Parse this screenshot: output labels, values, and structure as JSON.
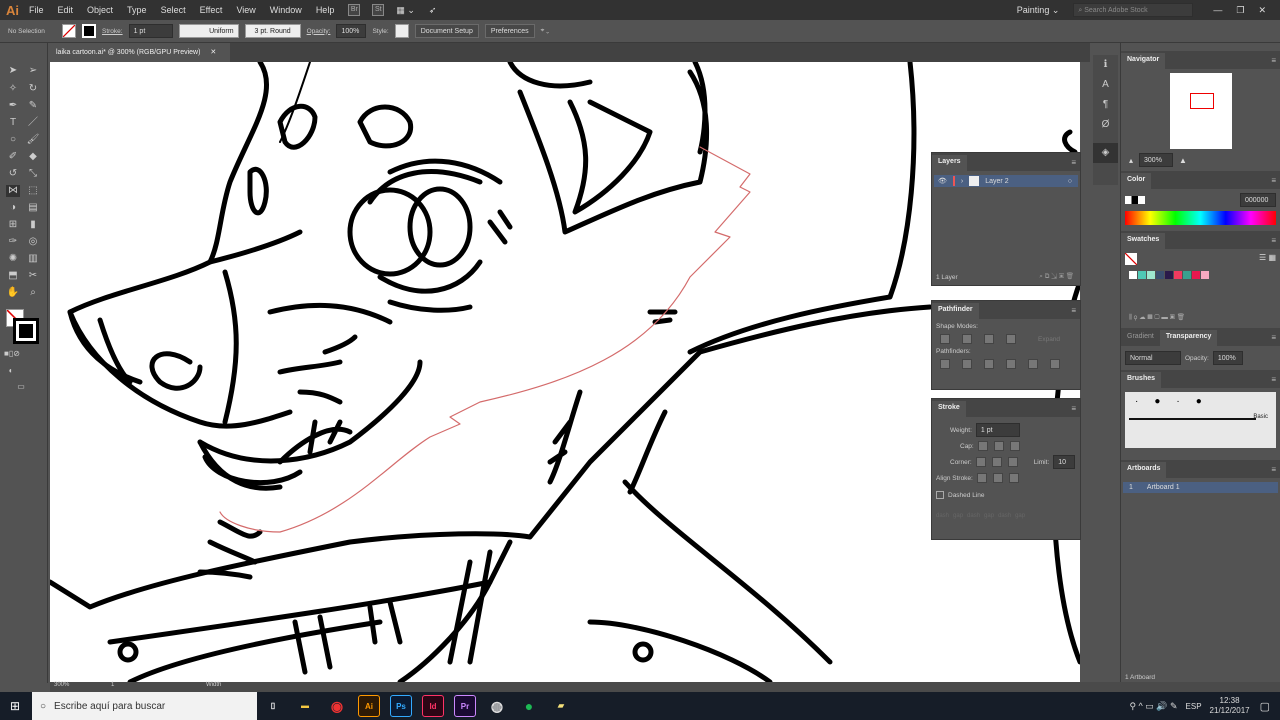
{
  "app": {
    "logo": "Ai",
    "menu": [
      "File",
      "Edit",
      "Object",
      "Type",
      "Select",
      "Effect",
      "View",
      "Window",
      "Help"
    ],
    "bridge": "Br",
    "stock": "St",
    "workspace": "Painting",
    "search_placeholder": "Search Adobe Stock"
  },
  "control": {
    "selection": "No Selection",
    "stroke_label": "Stroke:",
    "stroke_weight": "1 pt",
    "profile": "Uniform",
    "brush": "3 pt. Round",
    "opacity_label": "Opacity:",
    "opacity": "100%",
    "style_label": "Style:",
    "document_setup": "Document Setup",
    "preferences": "Preferences"
  },
  "document": {
    "tab": "laika cartoon.ai* @ 300% (RGB/GPU Preview)"
  },
  "layers": {
    "title": "Layers",
    "layer_name": "Layer 2",
    "count": "1 Layer"
  },
  "pathfinder": {
    "title": "Pathfinder",
    "shape_modes": "Shape Modes:",
    "expand": "Expand",
    "pathfinders": "Pathfinders:"
  },
  "stroke": {
    "title": "Stroke",
    "weight_label": "Weight:",
    "weight": "1 pt",
    "cap_label": "Cap:",
    "corner_label": "Corner:",
    "limit_label": "Limit:",
    "limit": "10",
    "align_label": "Align Stroke:",
    "dashed": "Dashed Line",
    "dash_fields": [
      "dash",
      "gap",
      "dash",
      "gap",
      "dash",
      "gap"
    ]
  },
  "navigator": {
    "title": "Navigator",
    "zoom": "300%"
  },
  "color": {
    "title": "Color",
    "hex": "000000"
  },
  "swatches": {
    "title": "Swatches",
    "colors": [
      "#ffffff",
      "#4fc9b5",
      "#9ee8cf",
      "#3b4f6e",
      "#2a1a4a",
      "#f03a5f",
      "#3aa08e",
      "#e8174f",
      "#f7a9c0"
    ]
  },
  "transparency": {
    "gradient_tab": "Gradient",
    "title": "Transparency",
    "mode": "Normal",
    "opacity_label": "Opacity:",
    "opacity": "100%"
  },
  "brushes": {
    "title": "Brushes",
    "basic": "Basic"
  },
  "artboards": {
    "title": "Artboards",
    "items": [
      {
        "num": "1",
        "name": "Artboard 1"
      }
    ],
    "count": "1 Artboard"
  },
  "status": {
    "zoom": "300%",
    "page": "1",
    "tool": "Width"
  },
  "taskbar": {
    "search": "Escribe aquí para buscar",
    "apps": [
      "Ai",
      "Ps",
      "Id",
      "Pr"
    ],
    "lang": "ESP",
    "time": "12:38",
    "date": "21/12/2017"
  }
}
